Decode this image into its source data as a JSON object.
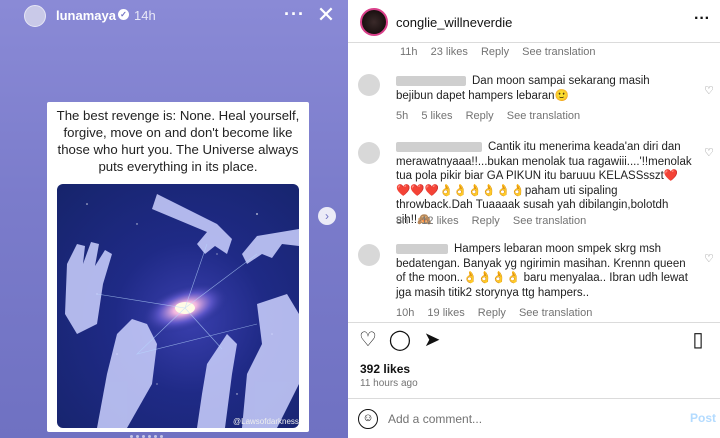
{
  "story": {
    "username": "lunamaya",
    "time": "14h",
    "quote": "The best revenge is: None. Heal yourself, forgive, move on and don't become like those who hurt you. The Universe always puts everything in its place.",
    "art_credit": "@Lawsofdarkness"
  },
  "post": {
    "username": "conglie_willneverdie",
    "first_meta": {
      "time": "11h",
      "likes": "23 likes",
      "reply": "Reply",
      "translate": "See translation"
    },
    "comments": [
      {
        "text": "Dan moon sampai sekarang masih bejibun dapet hampers lebaran🙂",
        "time": "5h",
        "likes": "5 likes",
        "reply": "Reply",
        "translate": "See translation"
      },
      {
        "text": "Cantik itu menerima keada'an diri dan merawatnyaaa!!...bukan menolak tua ragawiii....'!!menolak tua pola pikir biar GA PIKUN itu baruuu KELASSsszt❤️❤️❤️❤️👌👌👌👌👌👌paham uti sipaling throwback.Dah Tuaaaak susah yah dibilangin,bolotdh sih!!🙈",
        "time": "8h",
        "likes": "12 likes",
        "reply": "Reply",
        "translate": "See translation"
      },
      {
        "text": "Hampers lebaran moon smpek skrg msh bedatengan. Banyak yg ngirimin masihan. Krennn queen of the moon..👌👌👌👌 baru menyalaa.. Ibran udh lewat jga masih titik2 storynya ttg hampers..",
        "time": "10h",
        "likes": "19 likes",
        "reply": "Reply",
        "translate": "See translation"
      }
    ],
    "likes_total": "392 likes",
    "posted_ago": "11 hours ago",
    "add_comment_placeholder": "Add a comment...",
    "post_label": "Post"
  },
  "colors": {
    "story_bg": "#7b7ccb",
    "link_disabled": "#b3dbff",
    "muted": "#737373"
  }
}
